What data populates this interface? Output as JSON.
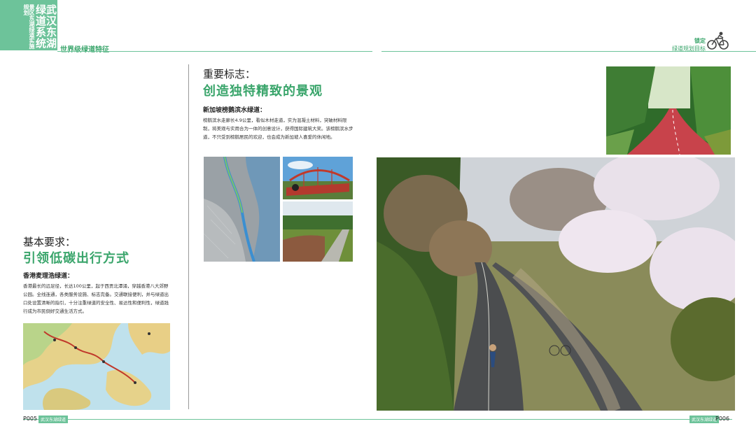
{
  "header": {
    "logo_main": "武汉东湖绿道系统",
    "logo_sub": "景区东湖绿道实施规划",
    "section_title": "世界级绿道特征",
    "right_title": "锁定",
    "right_subtitle": "绿道规划目标"
  },
  "left": {
    "heading": "基本要求：",
    "subheading": "引领低碳出行方式",
    "case_title": "香港麦理浩绿道：",
    "case_body": "香港最长的远足径，长达100公里，起于西贡北潭涌，穿越香港八大郊野公园。全线连通，各类服务设施、标志完备。交通联接便利，并与绿道出口处设置清晰的指引，十分注重绿道的安全性、易达性和便利性，绿道践行成为市民倒好交通生活方式。"
  },
  "middle": {
    "heading": "重要标志：",
    "subheading": "创造独特精致的景观",
    "case_title": "新加坡榜鹅滨水绿道：",
    "case_body": "榜鹅滨水走廊长4.9公里，看似木材走道，实为混凝土材料，突破材料限制，将美观与实用合为一体的创意设计，获得国际建筑大奖。该榜鹅滨水步道，不只受到榜鹅居民的欢迎，也会成为新加坡人喜爱的休闲地。"
  },
  "footer": {
    "page_left": "P005",
    "tag_left": "武汉东湖绿道",
    "page_right": "P006",
    "tag_right": "武汉东湖绿道"
  },
  "colors": {
    "accent": "#6dc39a",
    "accent_dark": "#3aa56b",
    "path_red": "#c8434b"
  }
}
